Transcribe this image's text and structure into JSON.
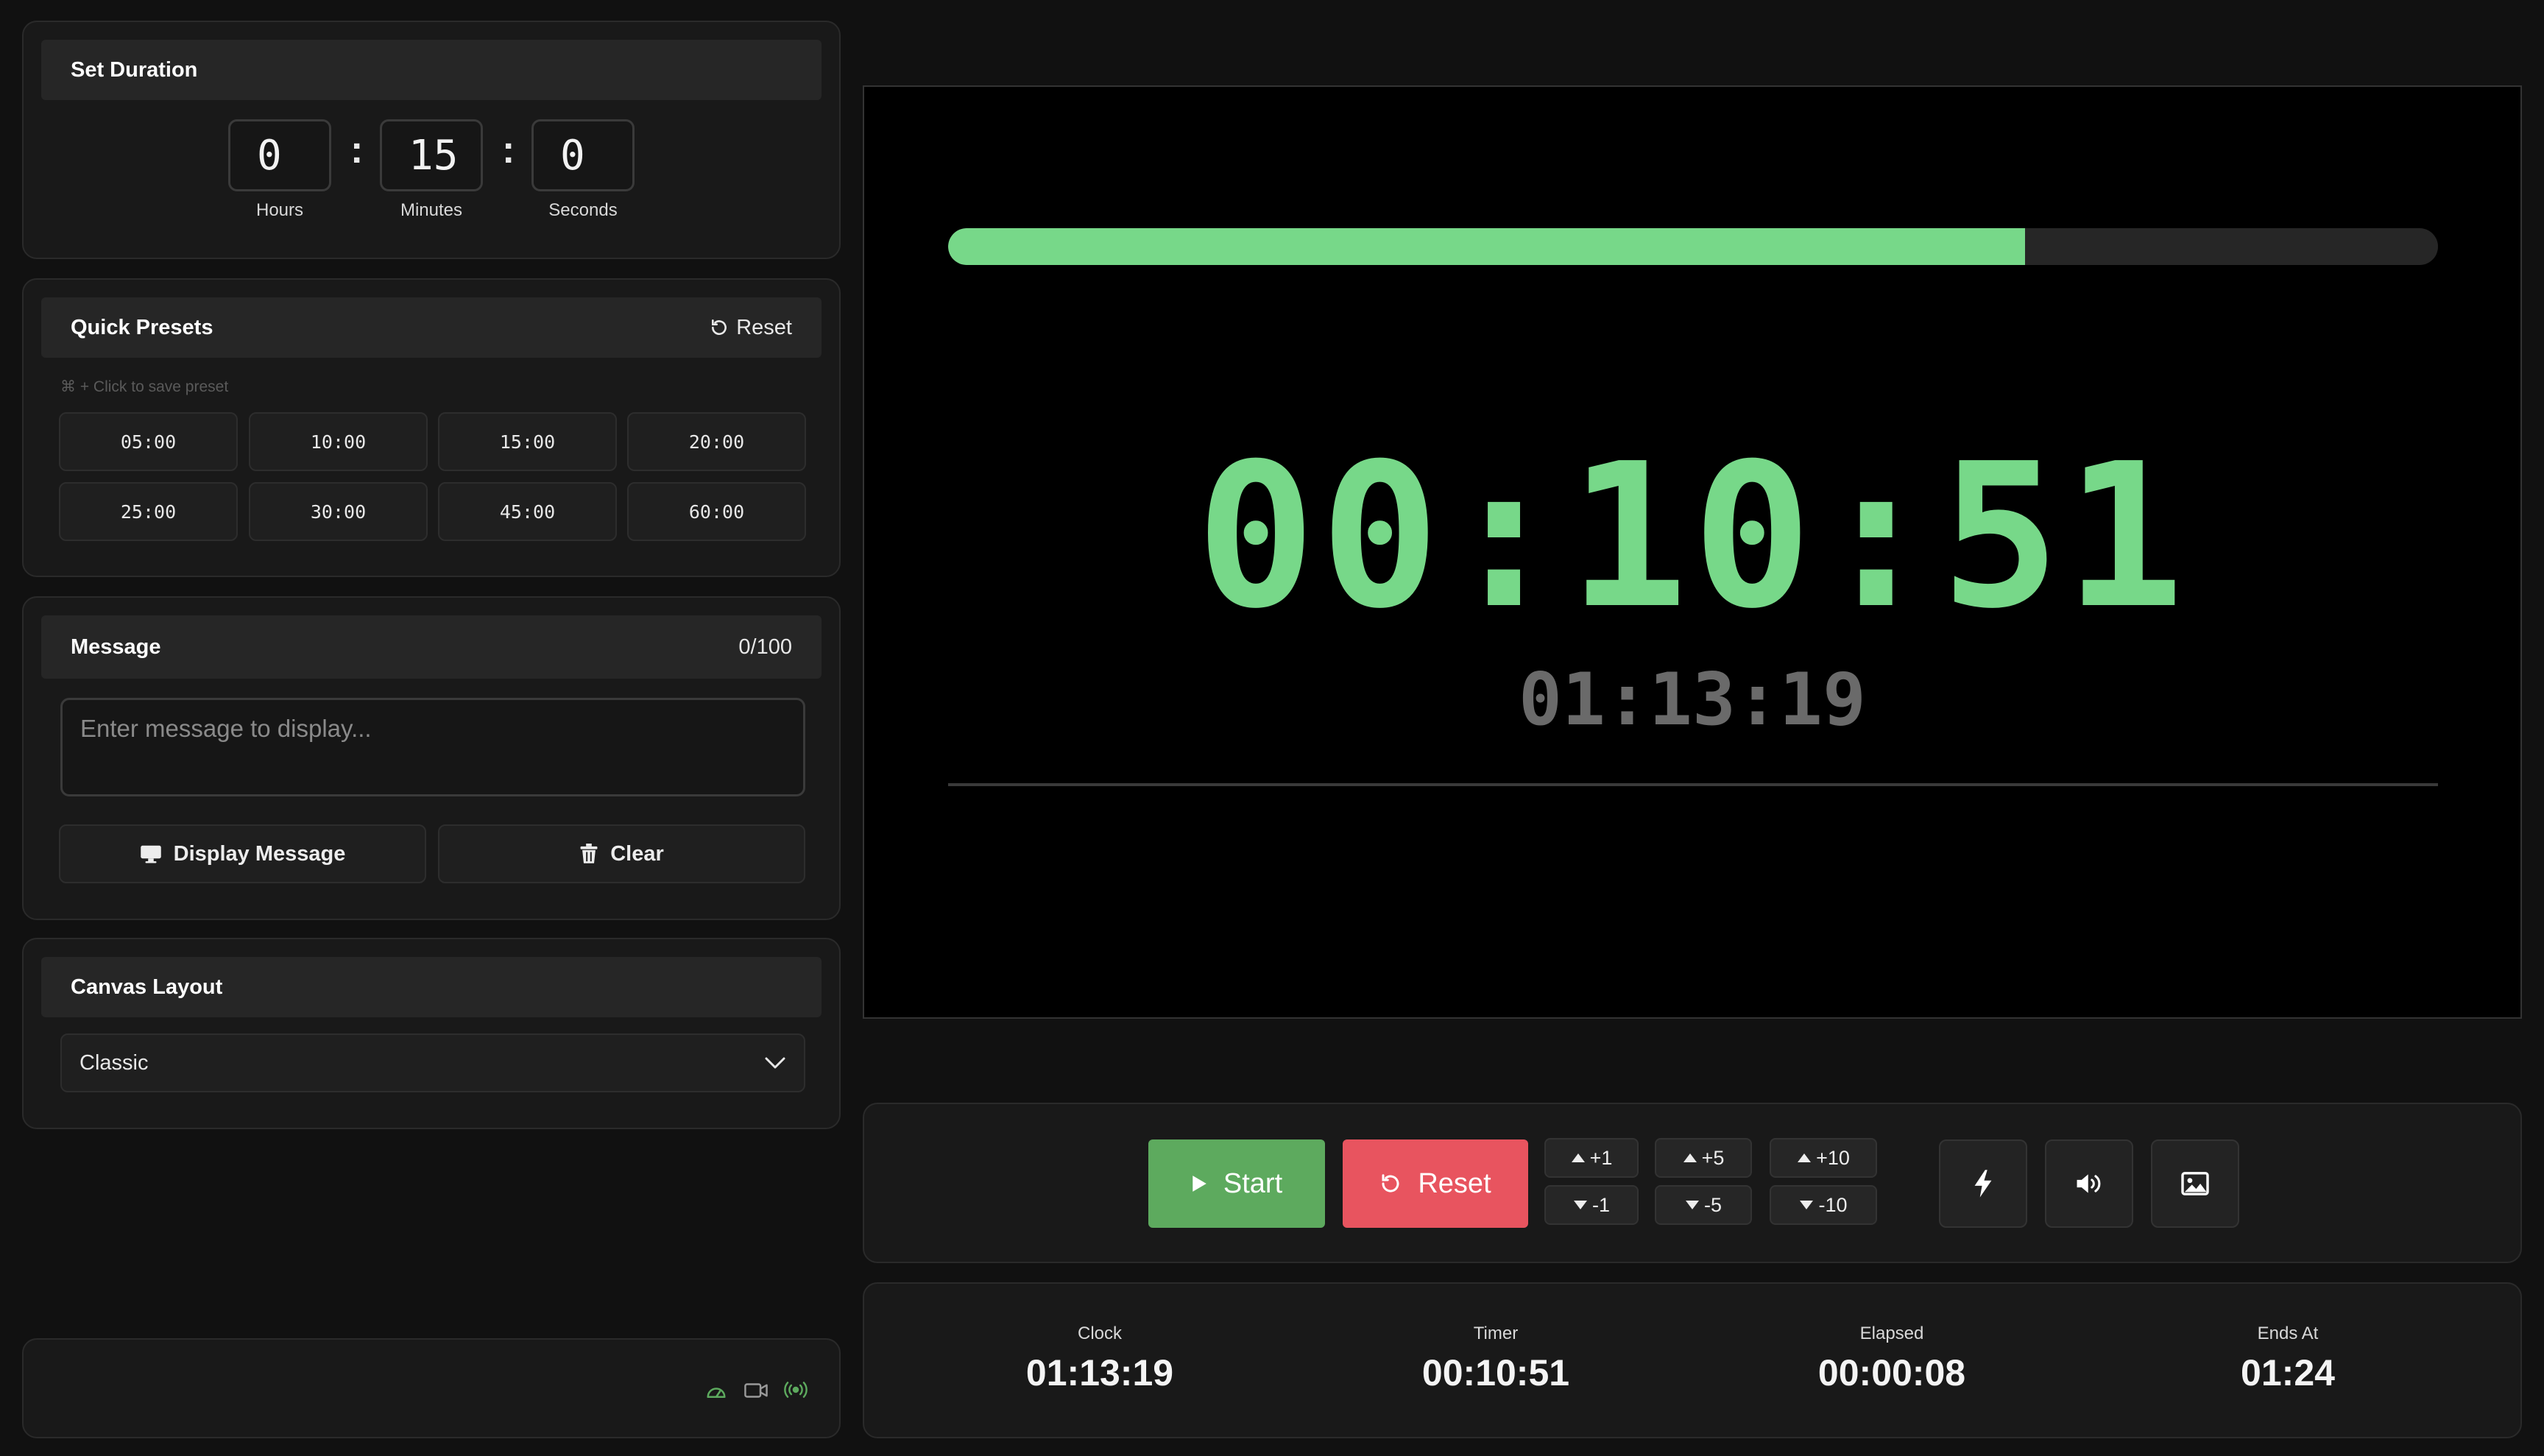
{
  "duration": {
    "title": "Set Duration",
    "hours": "0",
    "minutes": "15",
    "seconds": "0",
    "separator": ":",
    "hours_label": "Hours",
    "minutes_label": "Minutes",
    "seconds_label": "Seconds"
  },
  "presets": {
    "title": "Quick Presets",
    "reset_label": "Reset",
    "hint": "⌘ + Click to save preset",
    "items": [
      "05:00",
      "10:00",
      "15:00",
      "20:00",
      "25:00",
      "30:00",
      "45:00",
      "60:00"
    ]
  },
  "message": {
    "title": "Message",
    "count": "0/100",
    "placeholder": "Enter message to display...",
    "display_label": "Display Message",
    "clear_label": "Clear"
  },
  "canvas_layout": {
    "title": "Canvas Layout",
    "selected": "Classic"
  },
  "display": {
    "progress": 0.723,
    "timer": "00:10:51",
    "clock": "01:13:19"
  },
  "controls": {
    "start_label": "Start",
    "reset_label": "Reset",
    "plus1": "+1",
    "minus1": "-1",
    "plus5": "+5",
    "minus5": "-5",
    "plus10": "+10",
    "minus10": "-10"
  },
  "stats": {
    "clock_label": "Clock",
    "clock_value": "01:13:19",
    "timer_label": "Timer",
    "timer_value": "00:10:51",
    "elapsed_label": "Elapsed",
    "elapsed_value": "00:00:08",
    "ends_label": "Ends At",
    "ends_value": "01:24"
  },
  "colors": {
    "accent_green": "#77d889",
    "start_green": "#5daa5e",
    "reset_red": "#e8545f",
    "background": "#111111"
  },
  "icons": {
    "status": [
      "dashboard-icon",
      "camera-icon",
      "broadcast-icon"
    ],
    "tools": [
      "flash-icon",
      "sound-icon",
      "image-icon"
    ]
  }
}
